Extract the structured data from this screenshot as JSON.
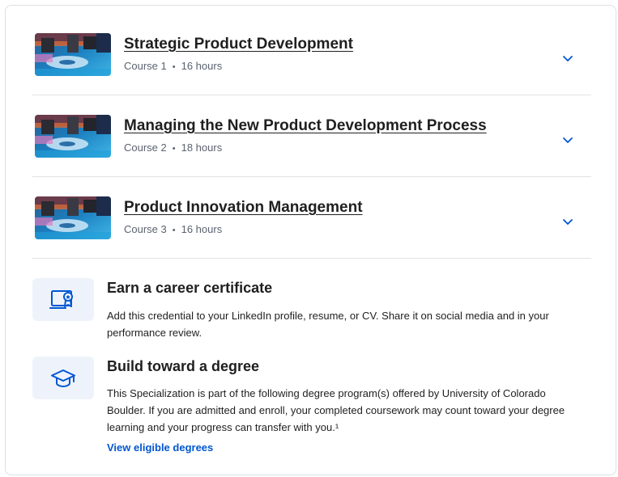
{
  "courses": [
    {
      "title": "Strategic Product Development",
      "course_label": "Course 1",
      "duration": "16 hours"
    },
    {
      "title": "Managing the New Product Development Process",
      "course_label": "Course 2",
      "duration": "18 hours"
    },
    {
      "title": "Product Innovation Management",
      "course_label": "Course 3",
      "duration": "16 hours"
    }
  ],
  "meta_separator": "•",
  "features": {
    "certificate": {
      "icon": "certificate-icon",
      "title": "Earn a career certificate",
      "description": "Add this credential to your LinkedIn profile, resume, or CV. Share it on social media and in your performance review."
    },
    "degree": {
      "icon": "graduation-cap-icon",
      "title": "Build toward a degree",
      "description": "This Specialization is part of the following degree program(s) offered by University of Colorado Boulder. If you are admitted and enroll, your completed coursework may count toward your degree learning and your progress can transfer with you.¹",
      "link_label": "View eligible degrees"
    }
  },
  "colors": {
    "accent_blue": "#0056d2",
    "icon_tile": "#eef3fb",
    "divider": "#e1e3e6",
    "meta_text": "#5b6370"
  }
}
